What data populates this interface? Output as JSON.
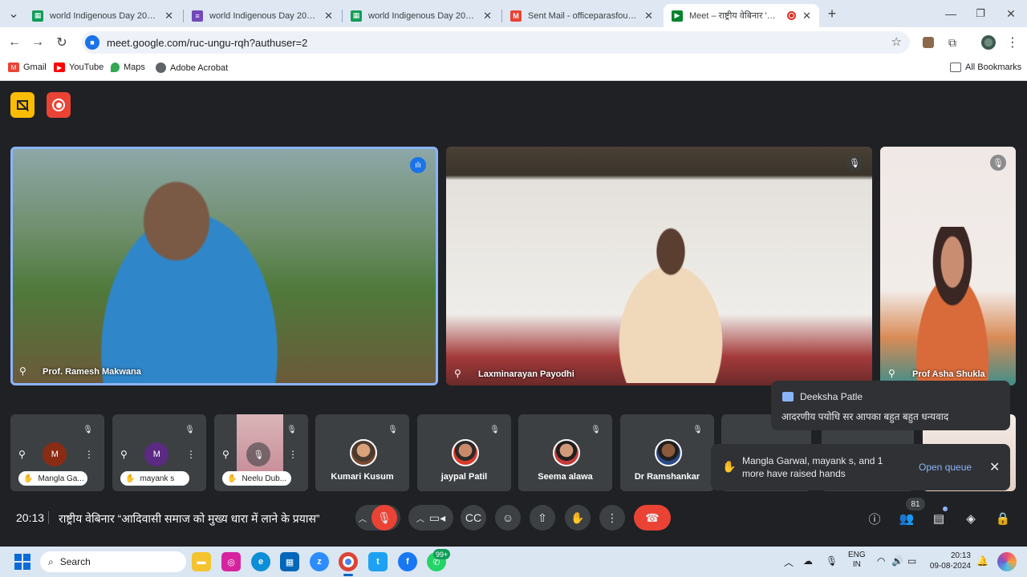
{
  "browser": {
    "tabs": [
      {
        "title": "world Indigenous Day 2024 (जन",
        "icon": "google-sheets-icon",
        "color": "#0f9d58"
      },
      {
        "title": "world Indigenous Day 2024 - G",
        "icon": "google-forms-icon",
        "color": "#7248b9"
      },
      {
        "title": "world Indigenous Day 2024 (जन",
        "icon": "google-sheets-icon",
        "color": "#0f9d58"
      },
      {
        "title": "Sent Mail - officeparasfoundati",
        "icon": "gmail-icon",
        "color": "#ea4335"
      },
      {
        "title": "Meet – राष्ट्रीय वेबिनार 'आदिवा",
        "icon": "google-meet-icon",
        "color": "#00832d",
        "active": true
      }
    ],
    "url": "meet.google.com/ruc-ungu-rqh?authuser=2",
    "bookmarks": [
      {
        "label": "Gmail",
        "icon": "gmail-icon",
        "color": "#ea4335"
      },
      {
        "label": "YouTube",
        "icon": "youtube-icon",
        "color": "#ff0000"
      },
      {
        "label": "Maps",
        "icon": "maps-icon",
        "color": "#34a853"
      },
      {
        "label": "Adobe Acrobat",
        "icon": "acrobat-icon",
        "color": "#5f6368"
      }
    ],
    "all_bookmarks": "All Bookmarks"
  },
  "meet": {
    "main_tiles": [
      {
        "name": "Prof. Ramesh Makwana",
        "speaking": true
      },
      {
        "name": "Laxminarayan Payodhi"
      },
      {
        "name": "Prof Asha Shukla"
      }
    ],
    "small_tiles": [
      {
        "name": "Mangla Ga...",
        "initial": "M",
        "avatar_color": "#8a2b14",
        "hand": true
      },
      {
        "name": "mayank s",
        "initial": "M",
        "avatar_color": "#5b2a82",
        "hand": true
      },
      {
        "name": "Neelu Dub...",
        "hand": true
      },
      {
        "name": "Kumari Kusum"
      },
      {
        "name": "jaypal Patil"
      },
      {
        "name": "Seema alawa"
      },
      {
        "name": "Dr Ramshankar"
      }
    ],
    "chat": {
      "sender": "Deeksha Patle",
      "message": "आदरणीय पयोधि सर आपका बहुत बहुत धन्यवाद"
    },
    "raise": {
      "text": "Mangla Garwal, mayank s, and 1 more have raised hands",
      "action": "Open queue"
    },
    "clock": "20:13",
    "meeting_title": "राष्ट्रीय वेबिनार “आदिवासी समाज को मुख्य धारा में लाने के प्रयास”",
    "participant_count": "81",
    "end_call_color": "#ea4335"
  },
  "taskbar": {
    "search": "Search",
    "whatsapp_badge": "99+",
    "lang": "ENG",
    "region": "IN",
    "time": "20:13",
    "date": "09-08-2024"
  }
}
